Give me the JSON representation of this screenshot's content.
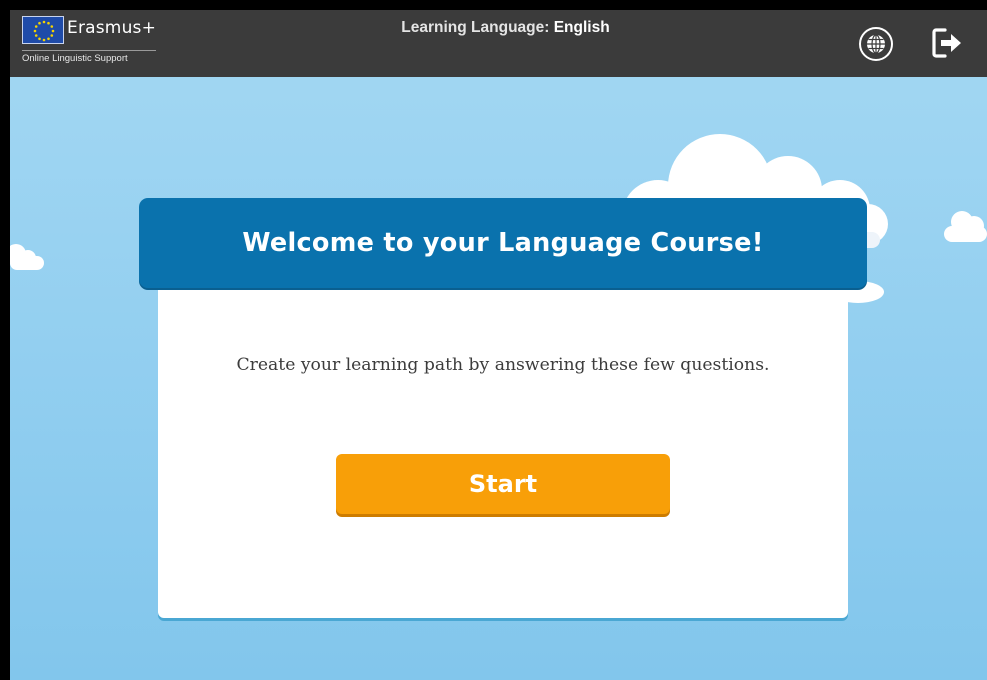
{
  "header": {
    "brand_name": "Erasmus+",
    "brand_subtitle": "Online Linguistic Support",
    "learning_language_label": "Learning Language:",
    "learning_language_value": "English",
    "icons": [
      "eu-flag-icon",
      "globe-icon",
      "logout-icon"
    ]
  },
  "card": {
    "title": "Welcome to your Language Course!",
    "description": "Create your learning path by answering these few questions.",
    "start_label": "Start"
  },
  "colors": {
    "topbar": "#3b3b3b",
    "sky": "#93cff0",
    "header_blue": "#0a72ad",
    "start_orange": "#f89f08"
  }
}
